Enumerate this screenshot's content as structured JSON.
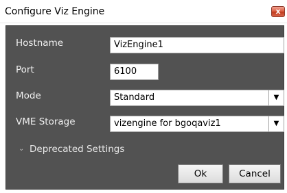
{
  "window": {
    "title": "Configure Viz Engine",
    "close_glyph": "x"
  },
  "form": {
    "hostname": {
      "label": "Hostname",
      "value": "VizEngine1"
    },
    "port": {
      "label": "Port",
      "value": "6100"
    },
    "mode": {
      "label": "Mode",
      "value": "Standard"
    },
    "vme_storage": {
      "label": "VME Storage",
      "value": "vizengine for bgoqaviz1"
    }
  },
  "expander": {
    "label": "Deprecated Settings",
    "icon": "chevron-down-icon",
    "expanded": false
  },
  "buttons": {
    "ok": "Ok",
    "cancel": "Cancel"
  },
  "colors": {
    "panel_background": "#525252",
    "label_text": "#f0f0f0",
    "close_button": "#c7452a"
  }
}
